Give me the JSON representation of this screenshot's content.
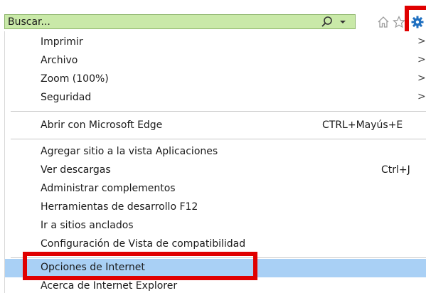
{
  "search": {
    "placeholder": "Buscar..."
  },
  "toolbar": {
    "search_icon": "search-icon",
    "dropdown_icon": "chevron-down-icon",
    "home_icon": "home-icon",
    "favorites_icon": "star-icon",
    "tools_icon": "gear-icon"
  },
  "menu": {
    "group1": [
      {
        "label": "Imprimir",
        "submenu": true
      },
      {
        "label": "Archivo",
        "submenu": true
      },
      {
        "label": "Zoom (100%)",
        "submenu": true
      },
      {
        "label": "Seguridad",
        "submenu": true
      }
    ],
    "group2": [
      {
        "label": "Abrir con Microsoft Edge",
        "shortcut": "CTRL+Mayús+E"
      }
    ],
    "group3": [
      {
        "label": "Agregar sitio a la vista Aplicaciones"
      },
      {
        "label": "Ver descargas",
        "shortcut": "Ctrl+J"
      },
      {
        "label": "Administrar complementos"
      },
      {
        "label": "Herramientas de desarrollo F12"
      },
      {
        "label": "Ir a sitios anclados"
      },
      {
        "label": "Configuración de Vista de compatibilidad"
      }
    ],
    "group4": [
      {
        "label": "Opciones de Internet"
      },
      {
        "label": "Acerca de Internet Explorer"
      }
    ],
    "arrow_glyph": ">"
  },
  "colors": {
    "search_bg": "#c9e9a8",
    "highlight": "#a9d0f5",
    "annotation_red": "#e00000"
  }
}
